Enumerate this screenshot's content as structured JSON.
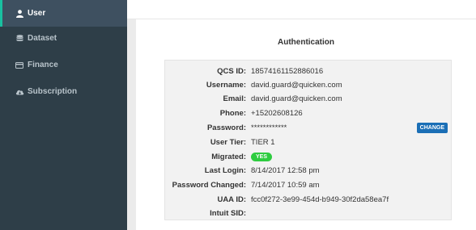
{
  "sidebar": {
    "items": [
      {
        "label": "User",
        "icon": "user-icon",
        "active": true
      },
      {
        "label": "Dataset",
        "icon": "database-icon",
        "active": false
      },
      {
        "label": "Finance",
        "icon": "credit-card-icon",
        "active": false
      },
      {
        "label": "Subscription",
        "icon": "cloud-download-icon",
        "active": false
      }
    ]
  },
  "card": {
    "title": "Authentication",
    "fields": [
      {
        "label": "QCS ID:",
        "value": "18574161152886016"
      },
      {
        "label": "Username:",
        "value": "david.guard@quicken.com"
      },
      {
        "label": "Email:",
        "value": "david.guard@quicken.com"
      },
      {
        "label": "Phone:",
        "value": "+15202608126"
      },
      {
        "label": "Password:",
        "value": "************"
      },
      {
        "label": "User Tier:",
        "value": "TIER 1"
      },
      {
        "label": "Migrated:",
        "value": "YES"
      },
      {
        "label": "Last Login:",
        "value": "8/14/2017 12:58 pm"
      },
      {
        "label": "Password Changed:",
        "value": "7/14/2017 10:59 am"
      },
      {
        "label": "UAA ID:",
        "value": "fcc0f272-3e99-454d-b949-30f2da58ea7f"
      },
      {
        "label": "Intuit SID:",
        "value": ""
      }
    ],
    "change_button": "CHANGE"
  },
  "colors": {
    "sidebar_bg": "#2e3e48",
    "active_accent": "#19c0a0",
    "change_button": "#1b6fb6",
    "yes_badge": "#2ecc40"
  }
}
